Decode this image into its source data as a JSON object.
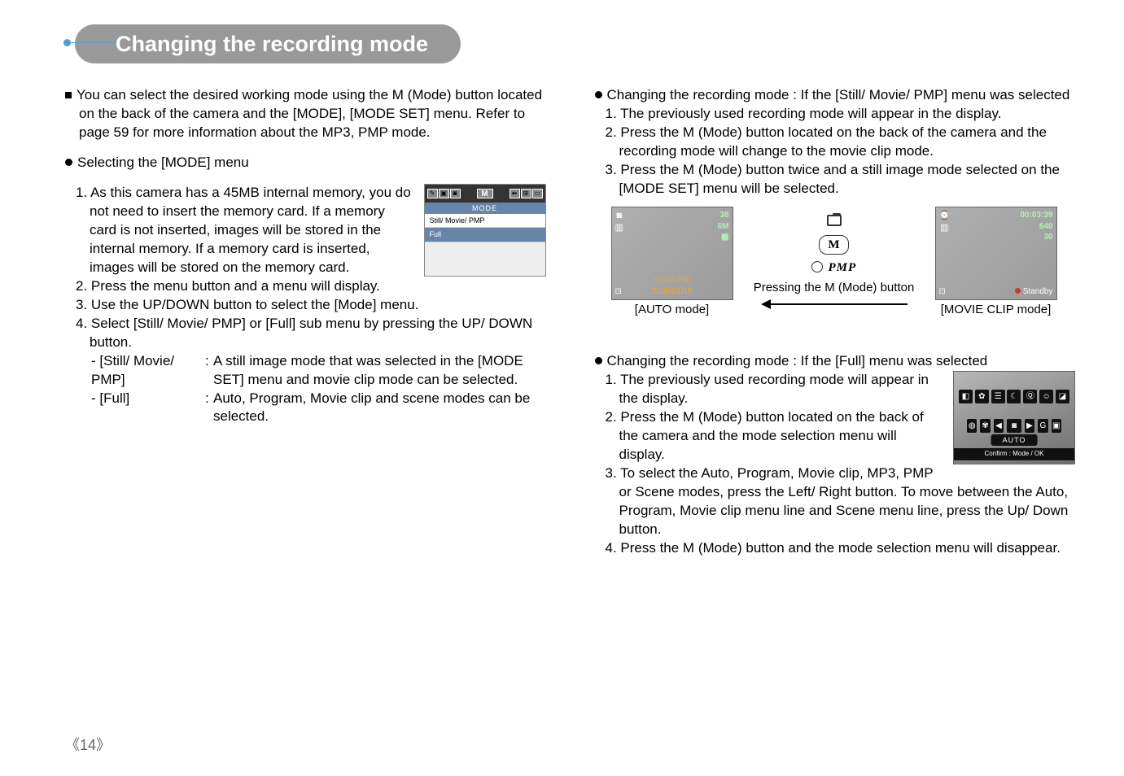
{
  "title": "Changing the recording mode",
  "left": {
    "intro": "You can select the desired working mode using the M (Mode) button located on the back of the camera and the [MODE], [MODE SET] menu. Refer to page 59 for more information about the MP3, PMP mode.",
    "sel_heading": "Selecting the [MODE] menu",
    "step1": "1. As this camera has a 45MB internal memory, you do not need to insert the memory card. If a memory card is not inserted, images will be stored in the internal memory. If a memory card is inserted, images will be stored on the memory card.",
    "step2": "2. Press the menu button and a menu will display.",
    "step3": "3. Use the UP/DOWN button to select the [Mode] menu.",
    "step4": "4. Select [Still/ Movie/ PMP] or [Full] sub menu by pressing the UP/ DOWN button.",
    "def1_label": "- [Still/ Movie/ PMP]",
    "def1_desc": "A still image mode that was selected in the [MODE SET] menu and movie clip mode can be selected.",
    "def2_label": "- [Full]",
    "def2_desc": "Auto, Program, Movie clip and scene modes can be selected.",
    "mini": {
      "M": "M",
      "mode": "MODE",
      "row1": "Still/ Movie/ PMP",
      "row2": "Full"
    }
  },
  "right": {
    "ch1_heading": "Changing the recording mode : If the [Still/ Movie/ PMP] menu was selected",
    "ch1_1": "1. The previously used recording mode will appear in the display.",
    "ch1_2": "2. Press the M (Mode) button located on the back of the camera and the recording mode will change to the movie clip mode.",
    "ch1_3": "3. Press the M (Mode) button twice and a still image mode selected on the [MODE SET] menu will be selected.",
    "diagram": {
      "auto": {
        "tr1": "38",
        "tr2": "6M",
        "bc1": "01:00 PM",
        "bc2": "2006/01/10",
        "caption": "[AUTO mode]"
      },
      "mid": {
        "m_label": "M",
        "pmp": "PMP",
        "caption": "Pressing the M (Mode) button"
      },
      "movie": {
        "tr1": "00:03:39",
        "tr2": "640",
        "tr3": "30",
        "br": "Standby",
        "caption": "[MOVIE CLIP mode]"
      }
    },
    "ch2_heading": "Changing the recording mode : If the [Full] menu was selected",
    "ch2_1": "1. The previously used recording mode will appear in the display.",
    "ch2_2": "2. Press the M (Mode) button located on the back of the camera and the mode selection menu will display.",
    "ch2_3": "3. To select the Auto, Program, Movie clip, MP3, PMP or Scene modes, press the Left/ Right button. To move between the Auto, Program, Movie clip menu line and Scene menu line, press the Up/ Down button.",
    "ch2_4": "4. Press the M (Mode) button and the mode selection menu will disappear.",
    "modemenu": {
      "label": "AUTO",
      "confirm": "Confirm : Mode / OK"
    }
  },
  "page": "14"
}
